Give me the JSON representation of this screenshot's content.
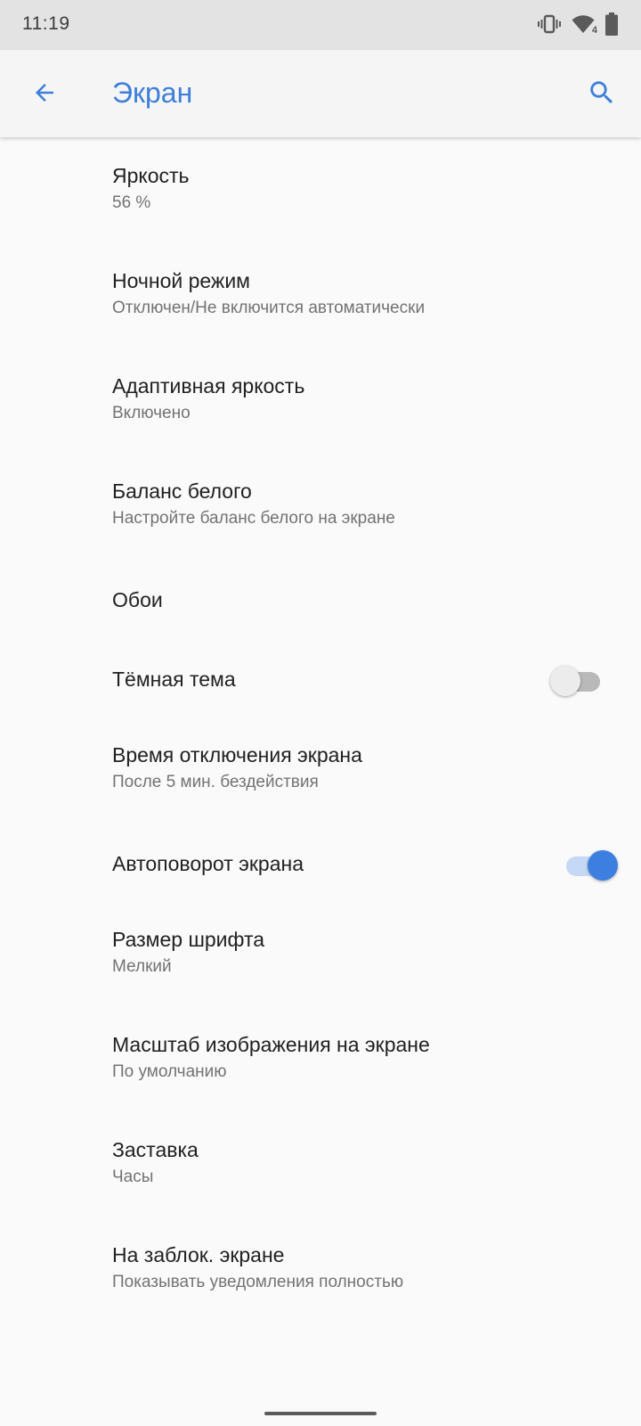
{
  "status_bar": {
    "time": "11:19",
    "icons": [
      "vibrate-icon",
      "wifi-icon",
      "battery-icon"
    ],
    "wifi_badge": "4"
  },
  "app_bar": {
    "title": "Экран",
    "back_icon": "arrow-back-icon",
    "search_icon": "search-icon",
    "accent_color": "#3d7fd9"
  },
  "settings": [
    {
      "title": "Яркость",
      "summary": "56 %"
    },
    {
      "title": "Ночной режим",
      "summary": "Отключен/Не включится автоматически"
    },
    {
      "title": "Адаптивная яркость",
      "summary": "Включено"
    },
    {
      "title": "Баланс белого",
      "summary": "Настройте баланс белого на экране"
    },
    {
      "title": "Обои"
    },
    {
      "title": "Тёмная тема",
      "toggle": false
    },
    {
      "title": "Время отключения экрана",
      "summary": "После 5 мин. бездействия"
    },
    {
      "title": "Автоповорот экрана",
      "toggle": true
    },
    {
      "title": "Размер шрифта",
      "summary": "Мелкий"
    },
    {
      "title": "Масштаб изображения на экране",
      "summary": "По умолчанию"
    },
    {
      "title": "Заставка",
      "summary": "Часы"
    },
    {
      "title": "На заблок. экране",
      "summary": "Показывать уведомления полностью"
    }
  ]
}
